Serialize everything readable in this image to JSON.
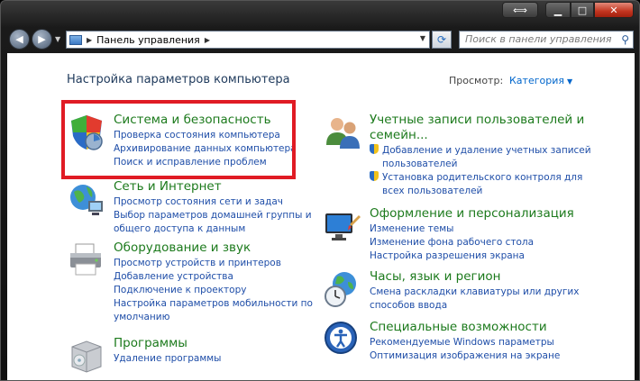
{
  "window": {
    "title_buttons": {
      "back": "⟺",
      "min": "▁",
      "max": "□",
      "close": "✕"
    }
  },
  "navbar": {
    "back": "◀",
    "forward": "▶",
    "dropdown": "▼",
    "address_sep1": "▶",
    "address_path": "Панель управления",
    "address_sep2": "▶",
    "address_drop": "▼",
    "refresh": "⟳",
    "search_placeholder": "Поиск в панели управления",
    "search_icon": "⚲"
  },
  "content": {
    "page_title": "Настройка параметров компьютера",
    "view_label": "Просмотр:",
    "view_value": "Категория",
    "view_arrow": "▼"
  },
  "categories": {
    "security": {
      "title": "Система и безопасность",
      "links": [
        "Проверка состояния компьютера",
        "Архивирование данных компьютера",
        "Поиск и исправление проблем"
      ]
    },
    "network": {
      "title": "Сеть и Интернет",
      "links": [
        "Просмотр состояния сети и задач",
        "Выбор параметров домашней группы и",
        "общего доступа к данным"
      ]
    },
    "hardware": {
      "title": "Оборудование и звук",
      "links": [
        "Просмотр устройств и принтеров",
        "Добавление устройства",
        "Подключение к проектору",
        "Настройка параметров мобильности по",
        "умолчанию"
      ]
    },
    "programs": {
      "title": "Программы",
      "links": [
        "Удаление программы"
      ]
    },
    "accounts": {
      "title_line1": "Учетные записи пользователей и",
      "title_line2": "семейн...",
      "links": [
        "Добавление и удаление учетных записей",
        "пользователей",
        "Установка родительского контроля для",
        "всех пользователей"
      ]
    },
    "appearance": {
      "title": "Оформление и персонализация",
      "links": [
        "Изменение темы",
        "Изменение фона рабочего стола",
        "Настройка разрешения экрана"
      ]
    },
    "clock": {
      "title": "Часы, язык и регион",
      "links": [
        "Смена раскладки клавиатуры или других",
        "способов ввода"
      ]
    },
    "access": {
      "title": "Специальные возможности",
      "links": [
        "Рекомендуемые Windows параметры",
        "Оптимизация изображения на экране"
      ]
    }
  },
  "icons": {
    "security": "shield-security-icon",
    "network": "network-globe-icon",
    "hardware": "printer-icon",
    "programs": "programs-box-icon",
    "accounts": "users-icon",
    "appearance": "monitor-paint-icon",
    "clock": "globe-clock-icon",
    "access": "accessibility-icon"
  }
}
